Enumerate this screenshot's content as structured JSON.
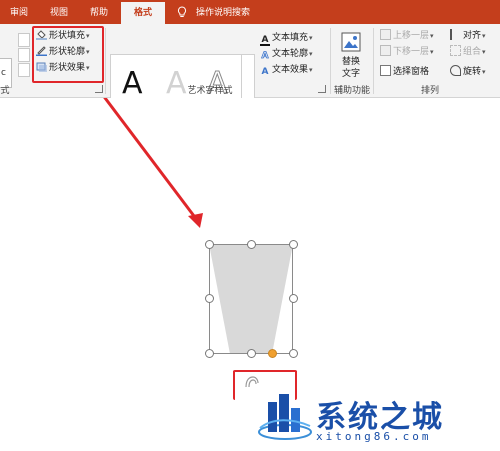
{
  "tabs": {
    "review": "审阅",
    "view": "视图",
    "help": "帮助",
    "format": "格式",
    "tell_me": "操作说明搜索"
  },
  "shape_styles": {
    "fill": "形状填充",
    "outline": "形状轮廓",
    "effects": "形状效果",
    "input_fragment": "c"
  },
  "wordart": {
    "sample_letter": "A",
    "text_fill": "文本填充",
    "text_outline": "文本轮廓",
    "text_effects": "文本效果",
    "group_label": "艺术字样式"
  },
  "accessibility": {
    "alt_text_line1": "替换",
    "alt_text_line2": "文字",
    "group_label": "辅助功能"
  },
  "arrange": {
    "bring_forward": "上移一层",
    "send_backward": "下移一层",
    "selection_pane": "选择窗格",
    "align": "对齐",
    "group": "组合",
    "rotate": "旋转",
    "group_label": "排列",
    "left_group_fragment": "式"
  },
  "watermark": {
    "title": "系统之城",
    "url": "xitong86.com"
  },
  "colors": {
    "accent": "#c43e1c",
    "highlight": "#e0262a",
    "shape_fill": "#d9d9d9",
    "watermark": "#1a4fa8"
  }
}
